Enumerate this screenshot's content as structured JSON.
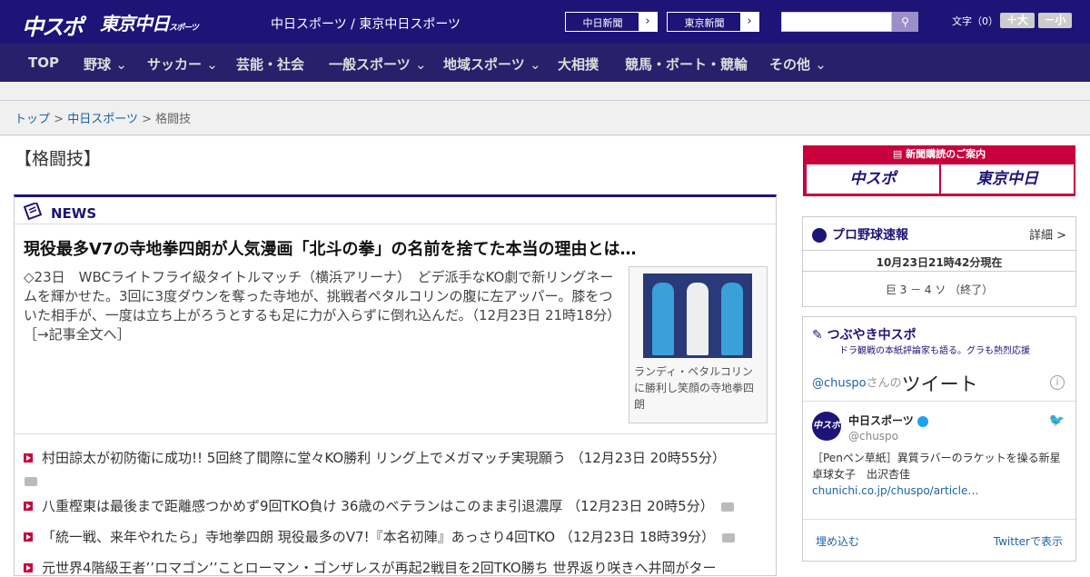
{
  "header": {
    "logo_chuspo": "中スポ",
    "logo_tokyo": "東京中日",
    "logo_tokyo_small": "スポーツ",
    "site_name": "中日スポーツ / 東京中日スポーツ",
    "btn_chunichi": "中日新聞",
    "btn_tokyo": "東京新聞",
    "search_placeholder": "",
    "fontsize_label": "文字（0）",
    "font_bigger": "＋大",
    "font_smaller": "－小",
    "bg_color": "#1e1478"
  },
  "nav": {
    "items": [
      "TOP",
      "野球",
      "サッカー",
      "芸能・社会",
      "一般スポーツ",
      "地域スポーツ",
      "大相撲",
      "競馬・ボート・競輪",
      "その他"
    ]
  },
  "breadcrumb": {
    "top": "トップ",
    "section": "中日スポーツ",
    "current": "格闘技",
    "sep1": ">",
    "sep2": ">"
  },
  "category_title": "【格闘技】",
  "news": {
    "heading": "NEWS",
    "headline": "現役最多V7の寺地拳四朗が人気漫画「北斗の拳」の名前を捨てた本当の理由とは…",
    "lead": "◇23日　WBCライトフライ級タイトルマッチ（横浜アリーナ）　どデ派手なKO劇で新リングネームを輝かせた。3回に3度ダウンを奪った寺地が、挑戦者ペタルコリンの腹に左アッパー。膝をついた相手が、一度は立ち上がろうとするも足に力が入らずに倒れ込んだ。（12月23日 21時18分）",
    "more_link": "［→記事全文へ］",
    "photo_caption": "ランディ・ペタルコリンに勝利し笑顔の寺地拳四朗",
    "items": [
      "村田諒太が初防衛に成功!! 5回終了間際に堂々KO勝利 リング上でメガマッチ実現願う （12月23日 20時55分）",
      "八重樫東は最後まで距離感つかめず9回TKO負け 36歳のベテランはこのまま引退濃厚 （12月23日 20時5分）",
      "「統一戦、来年やれたら」寺地拳四朗 現役最多のV7!『本名初陣』あっさり4回TKO （12月23日 18時39分）",
      "元世界4階級王者’’ロマゴン’’ことローマン・ゴンザレスが再起2戦目を2回TKO勝ち 世界返り咲きへ井岡がター"
    ]
  },
  "sidebar": {
    "ad_title": "新聞購読のご案内",
    "ad_left": "中スポ",
    "ad_right": "東京中日",
    "baseball": {
      "title": "プロ野球速報",
      "detail": "詳細 >",
      "timestamp": "10月23日21時42分現在",
      "score": "巨 3 － 4 ソ （終了）"
    },
    "twitter": {
      "title": "つぶやき中スポ",
      "subtitle": "ドラ観戦の本紙評論家も語る。グラも熱烈応援",
      "handle_link": "@chuspo",
      "handle_suffix": "さんの",
      "tweets_label": "ツイート",
      "info": "i",
      "avatar": "中スポ",
      "user_name": "中日スポーツ",
      "user_handle": "@chuspo",
      "tweet_text": "［Penペン草紙］異質ラバーのラケットを操る新星　卓球女子　出沢杏佳",
      "tweet_link": "chunichi.co.jp/chuspo/article…",
      "embed": "埋め込む",
      "view_on_twitter": "Twitterで表示"
    }
  }
}
